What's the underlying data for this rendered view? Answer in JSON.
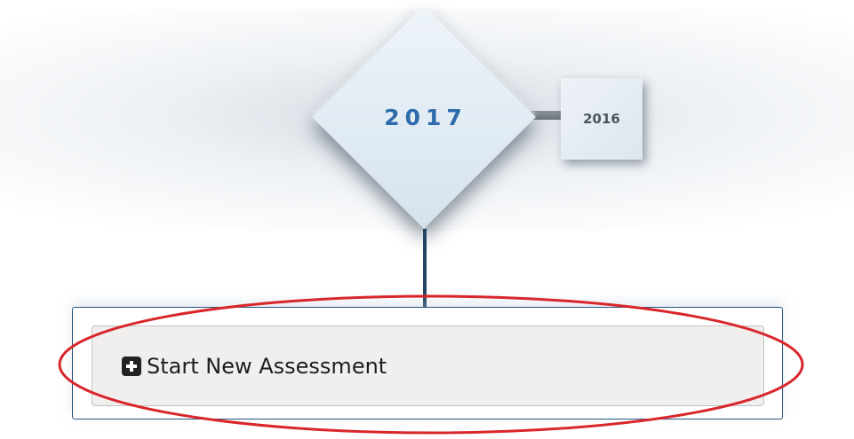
{
  "timeline": {
    "current_year": "2017",
    "previous_year": "2016"
  },
  "assessment": {
    "start_label": "Start New Assessment",
    "start_icon": "plus-square-icon"
  },
  "annotation": {
    "shape": "ellipse",
    "color": "#d9262b"
  },
  "colors": {
    "year_text": "#2e6bab",
    "panel_border": "#2a557f",
    "connector_line": "#1f4466"
  }
}
